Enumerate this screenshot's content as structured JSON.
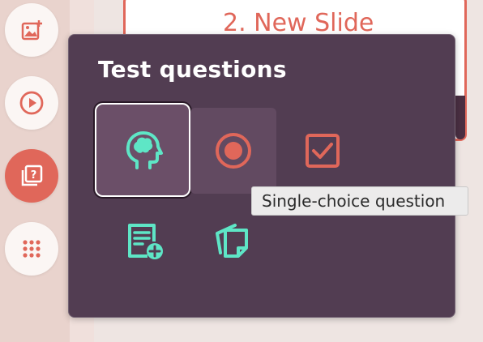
{
  "slide": {
    "title": "2. New Slide"
  },
  "rail": {
    "items": [
      {
        "icon": "image-add-icon",
        "active": false
      },
      {
        "icon": "play-icon",
        "active": false
      },
      {
        "icon": "question-library-icon",
        "active": true
      },
      {
        "icon": "apps-grid-icon",
        "active": false
      }
    ]
  },
  "popup": {
    "title": "Test questions",
    "options": [
      {
        "icon": "brain-head-icon",
        "state": "selected"
      },
      {
        "icon": "radio-button-icon",
        "state": "hover"
      },
      {
        "icon": "checkbox-icon",
        "state": "normal"
      },
      {
        "icon": "document-add-icon",
        "state": "normal"
      },
      {
        "icon": "stacked-cards-icon",
        "state": "normal"
      }
    ]
  },
  "tooltip": {
    "text": "Single-choice question"
  },
  "colors": {
    "accent": "#e0675a",
    "teal": "#5ee6c6",
    "panel": "#523d52"
  }
}
